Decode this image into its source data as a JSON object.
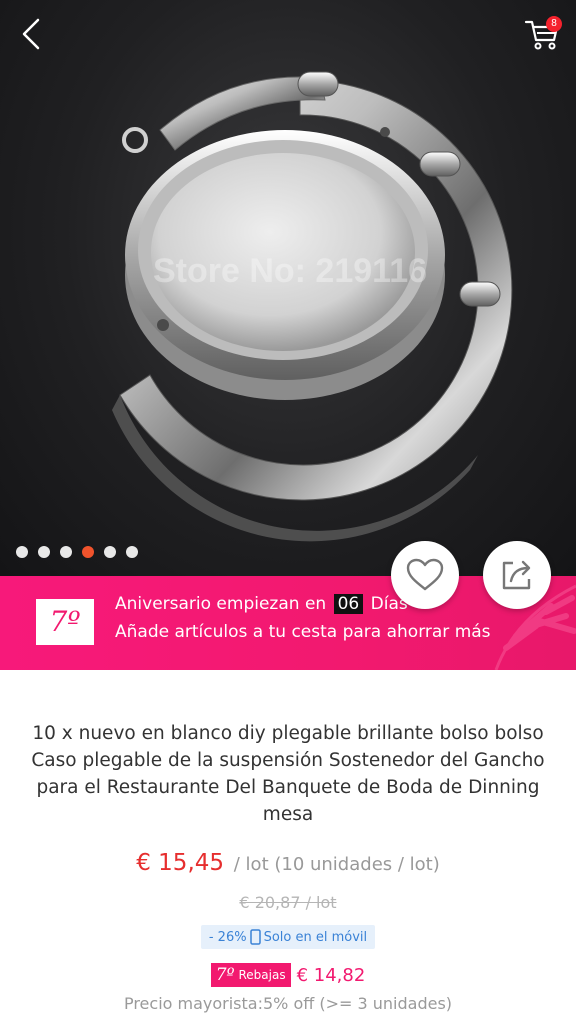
{
  "header": {
    "back_icon": "chevron-left-icon",
    "cart_icon": "cart-icon",
    "cart_count": "8"
  },
  "gallery": {
    "watermark": "Store No: 219116",
    "image_count": 6,
    "active_index": 3
  },
  "actions": {
    "favorite_icon": "heart-icon",
    "share_icon": "share-icon"
  },
  "promo": {
    "logo_text": "7º",
    "line1_before": "Aniversario empiezan en",
    "days_count": "06",
    "line1_after": "Días",
    "line2": "Añade artículos a tu cesta para ahorrar más",
    "color": "#f2196f"
  },
  "product": {
    "title": "10 x nuevo en blanco diy plegable brillante bolso bolso Caso plegable de la suspensión Sostenedor del Gancho para el Restaurante Del Banquete de Boda de Dinning mesa",
    "price": "€ 15,45",
    "price_unit": "/ lot (10 unidades / lot)",
    "old_price": "€ 20,87  / lot",
    "discount": "- 26%",
    "mobile_only": "Solo en el móvil",
    "sale_badge_num": "7º",
    "sale_badge_label": "Rebajas",
    "sale_price": "€ 14,82",
    "wholesale": "Precio mayorista:5% off (>= 3 unidades)",
    "price_color": "#e62e2e"
  }
}
